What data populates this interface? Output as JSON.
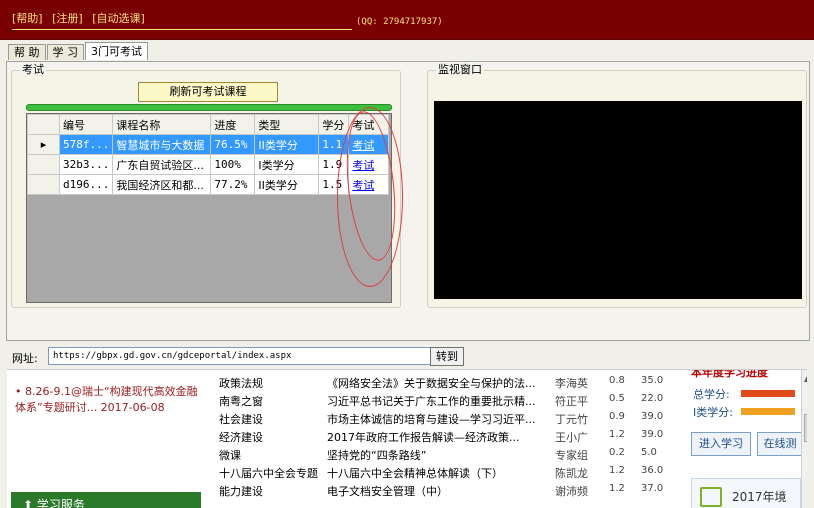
{
  "topbar": {
    "links": [
      "[帮助]",
      "[注册]",
      "[自动选课]"
    ],
    "qq": "(QQ: 2794717937)"
  },
  "tabs": [
    {
      "label": "帮 助"
    },
    {
      "label": "学 习"
    },
    {
      "label": "3门可考试"
    }
  ],
  "exam": {
    "group_title": "考试",
    "refresh_label": "刷新可考试课程",
    "columns": [
      "编号",
      "课程名称",
      "进度",
      "类型",
      "学分",
      "考试"
    ],
    "rows": [
      {
        "id": "578f...",
        "name": "智慧城市与大数据",
        "progress": "76.5%",
        "type": "II类学分",
        "credit": "1.1",
        "exam": "考试"
      },
      {
        "id": "32b3...",
        "name": "广东自贸试验区...",
        "progress": "100%",
        "type": "I类学分",
        "credit": "1.9",
        "exam": "考试"
      },
      {
        "id": "d196...",
        "name": "我国经济区和都...",
        "progress": "77.2%",
        "type": "II类学分",
        "credit": "1.5",
        "exam": "考试"
      }
    ]
  },
  "monitor": {
    "group_title": "监视窗口"
  },
  "address": {
    "label": "网址:",
    "value": "https://gbpx.gd.gov.cn/gdceportal/index.aspx",
    "go_label": "转到"
  },
  "web": {
    "news_left": "• 8.26-9.1@瑞士“构建现代高效金融体系”专题研讨... 2017-06-08",
    "green_bar": "学习服务",
    "courses": [
      {
        "category": "政策法规",
        "title": "《网络安全法》关于数据安全与保护的法...",
        "teacher": "李海英",
        "credit": "0.8",
        "hours": "35.0"
      },
      {
        "category": "南粤之窗",
        "title": "习近平总书记关于广东工作的重要批示精...",
        "teacher": "符正平",
        "credit": "0.5",
        "hours": "22.0"
      },
      {
        "category": "社会建设",
        "title": "市场主体诚信的培育与建设—学习习近平...",
        "teacher": "丁元竹",
        "credit": "0.9",
        "hours": "39.0"
      },
      {
        "category": "经济建设",
        "title": "2017年政府工作报告解读—经济政策...",
        "teacher": "王小广",
        "credit": "1.2",
        "hours": "39.0"
      },
      {
        "category": "微课",
        "title": "坚持党的“四条路线”",
        "teacher": "专家组",
        "credit": "0.2",
        "hours": "5.0"
      },
      {
        "category": "十八届六中全会专题",
        "title": "十八届六中全会精神总体解读（下）",
        "teacher": "陈凯龙",
        "credit": "1.2",
        "hours": "36.0"
      },
      {
        "category": "能力建设",
        "title": "电子文档安全管理（中）",
        "teacher": "谢沛频",
        "credit": "1.2",
        "hours": "37.0"
      }
    ],
    "right": {
      "title": "本年度学习进度",
      "total_label": "总学分:",
      "class1_label": "I类学分:",
      "enter_label": "进入学习",
      "online_label": "在线测",
      "card_text": "2017年境",
      "colors": {
        "total": "#e04a1a",
        "class1": "#f0a020"
      }
    }
  }
}
